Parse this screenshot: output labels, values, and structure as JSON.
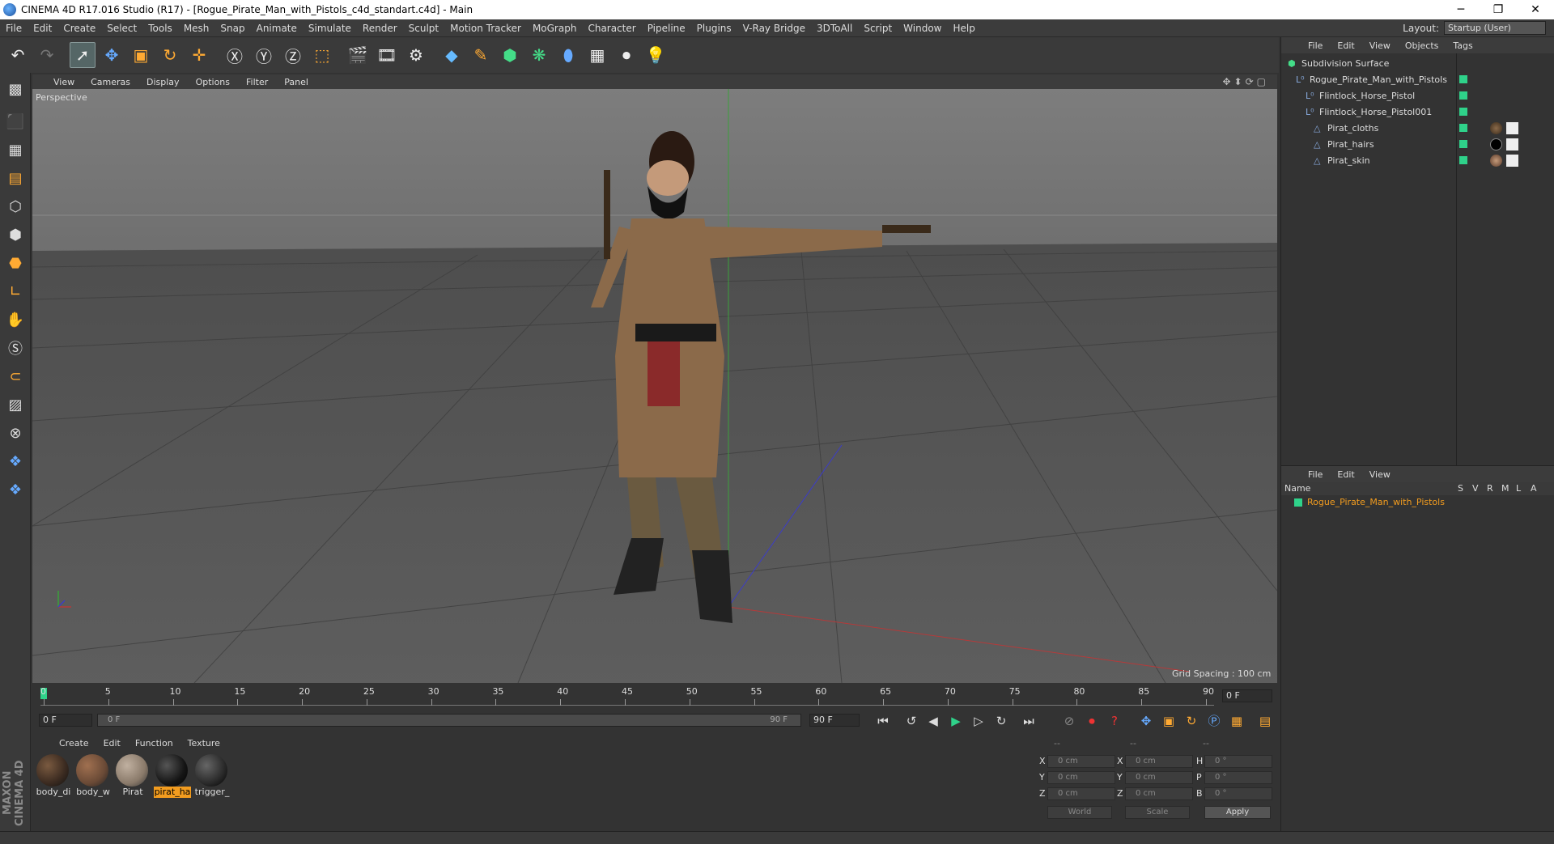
{
  "window": {
    "title": "CINEMA 4D R17.016 Studio (R17) - [Rogue_Pirate_Man_with_Pistols_c4d_standart.c4d] - Main",
    "buttons": [
      "─",
      "❐",
      "✕"
    ]
  },
  "menubar": {
    "items": [
      "File",
      "Edit",
      "Create",
      "Select",
      "Tools",
      "Mesh",
      "Snap",
      "Animate",
      "Simulate",
      "Render",
      "Sculpt",
      "Motion Tracker",
      "MoGraph",
      "Character",
      "Pipeline",
      "Plugins",
      "V-Ray Bridge",
      "3DToAll",
      "Script",
      "Window",
      "Help"
    ],
    "layout_label": "Layout:",
    "layout_value": "Startup (User)"
  },
  "toolbar": {
    "icons": [
      "undo-icon",
      "redo-icon",
      "select-arrow-icon",
      "move-icon",
      "scale-icon",
      "rotate-icon",
      "transform-icon",
      "x-axis-icon",
      "y-axis-icon",
      "z-axis-icon",
      "coordinate-system-icon",
      "render-view-icon",
      "render-picture-viewer-icon",
      "render-settings-icon",
      "cube-icon",
      "pen-icon",
      "subdivision-icon",
      "cloner-icon",
      "deformer-icon",
      "floor-icon",
      "camera-icon",
      "light-icon"
    ]
  },
  "viewport": {
    "menu": [
      "View",
      "Cameras",
      "Display",
      "Options",
      "Filter",
      "Panel"
    ],
    "label": "Perspective",
    "grid_spacing": "Grid Spacing : 100 cm"
  },
  "objects": {
    "menu": [
      "File",
      "Edit",
      "View",
      "Objects",
      "Tags"
    ],
    "items": [
      {
        "name": "Subdivision Surface",
        "icon": "subdivision-icon"
      },
      {
        "name": "Rogue_Pirate_Man_with_Pistols",
        "icon": "null-icon"
      },
      {
        "name": "Flintlock_Horse_Pistol",
        "icon": "null-icon"
      },
      {
        "name": "Flintlock_Horse_Pistol001",
        "icon": "null-icon"
      },
      {
        "name": "Pirat_cloths",
        "icon": "polygon-icon"
      },
      {
        "name": "Pirat_hairs",
        "icon": "polygon-icon"
      },
      {
        "name": "Pirat_skin",
        "icon": "polygon-icon"
      }
    ]
  },
  "attributes": {
    "menu": [
      "File",
      "Edit",
      "View"
    ],
    "columns": [
      "Name",
      "S",
      "V",
      "R",
      "M",
      "L",
      "A"
    ],
    "row": "Rogue_Pirate_Man_with_Pistols",
    "row_color": "#f29c1f"
  },
  "timeline": {
    "ticks": [
      "0",
      "5",
      "10",
      "15",
      "20",
      "25",
      "30",
      "35",
      "40",
      "45",
      "50",
      "55",
      "60",
      "65",
      "70",
      "75",
      "80",
      "85",
      "90"
    ],
    "current_frame": "0 F",
    "start_field": "0 F",
    "range_start": "0 F",
    "range_end": "90 F",
    "end_field": "90 F"
  },
  "materials": {
    "menu": [
      "Create",
      "Edit",
      "Function",
      "Texture"
    ],
    "items": [
      {
        "label": "body_di",
        "color": "#3a2a20"
      },
      {
        "label": "body_w",
        "color": "#6a4a36"
      },
      {
        "label": "Pirat",
        "color": "#8a7a6a"
      },
      {
        "label": "pirat_ha",
        "color": "#151515"
      },
      {
        "label": "trigger_",
        "color": "#2a2a2a"
      }
    ],
    "selected_index": 3
  },
  "coordinates": {
    "header": [
      "--",
      "--",
      "--"
    ],
    "rows": [
      {
        "a_label": "X",
        "a_val": "0 cm",
        "b_label": "X",
        "b_val": "0 cm",
        "c_label": "H",
        "c_val": "0 °"
      },
      {
        "a_label": "Y",
        "a_val": "0 cm",
        "b_label": "Y",
        "b_val": "0 cm",
        "c_label": "P",
        "c_val": "0 °"
      },
      {
        "a_label": "Z",
        "a_val": "0 cm",
        "b_label": "Z",
        "b_val": "0 cm",
        "c_label": "B",
        "c_val": "0 °"
      }
    ],
    "mode_world": "World",
    "mode_scale": "Scale",
    "apply": "Apply"
  },
  "brand": "MAXON CINEMA 4D",
  "colors": {
    "accent": "#f29c1f",
    "object_dot": "#2fd28a",
    "timeline_marker": "#2fd28a"
  }
}
